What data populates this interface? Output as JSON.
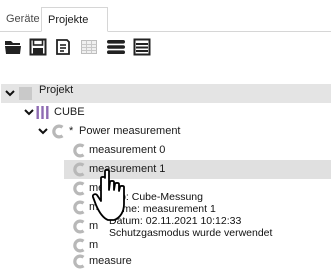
{
  "tabs": [
    {
      "label": "Geräte"
    },
    {
      "label": "Projekte"
    }
  ],
  "toolbar": {
    "icons": [
      "open-folder-icon",
      "save-icon",
      "notes-icon",
      "table-icon",
      "stack-icon",
      "list-icon"
    ]
  },
  "tree": {
    "root": {
      "label": "Projekt"
    },
    "cube": {
      "label": "CUBE"
    },
    "measurement_group": {
      "marker": "*",
      "label": "Power measurement"
    },
    "items": [
      {
        "label": "measurement 0"
      },
      {
        "label": "measurement 1"
      },
      {
        "label": "measure"
      },
      {
        "label": "m"
      },
      {
        "label": "m"
      },
      {
        "label": "m"
      },
      {
        "label": "measure"
      }
    ]
  },
  "tooltip": {
    "lines": [
      "Typ: Cube-Messung",
      "Name: measurement 1",
      "Datum: 02.11.2021 10:12:33",
      "Schutzgasmodus wurde verwendet"
    ]
  },
  "colors": {
    "c_icon": "#b8b8b8",
    "cube_icon": "#8e6bb3",
    "selected_bg": "#e0e0e0",
    "header_bg": "#e4e4e4"
  }
}
